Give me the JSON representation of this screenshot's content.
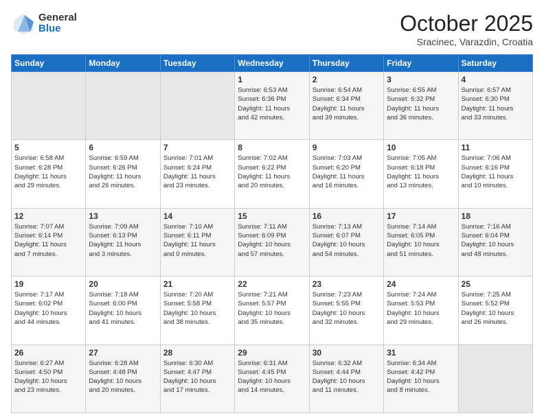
{
  "header": {
    "logo_general": "General",
    "logo_blue": "Blue",
    "month_title": "October 2025",
    "location": "Sracinec, Varazdin, Croatia"
  },
  "days_of_week": [
    "Sunday",
    "Monday",
    "Tuesday",
    "Wednesday",
    "Thursday",
    "Friday",
    "Saturday"
  ],
  "weeks": [
    [
      {
        "day": "",
        "info": ""
      },
      {
        "day": "",
        "info": ""
      },
      {
        "day": "",
        "info": ""
      },
      {
        "day": "1",
        "info": "Sunrise: 6:53 AM\nSunset: 6:36 PM\nDaylight: 11 hours\nand 42 minutes."
      },
      {
        "day": "2",
        "info": "Sunrise: 6:54 AM\nSunset: 6:34 PM\nDaylight: 11 hours\nand 39 minutes."
      },
      {
        "day": "3",
        "info": "Sunrise: 6:55 AM\nSunset: 6:32 PM\nDaylight: 11 hours\nand 36 minutes."
      },
      {
        "day": "4",
        "info": "Sunrise: 6:57 AM\nSunset: 6:30 PM\nDaylight: 11 hours\nand 33 minutes."
      }
    ],
    [
      {
        "day": "5",
        "info": "Sunrise: 6:58 AM\nSunset: 6:28 PM\nDaylight: 11 hours\nand 29 minutes."
      },
      {
        "day": "6",
        "info": "Sunrise: 6:59 AM\nSunset: 6:26 PM\nDaylight: 11 hours\nand 26 minutes."
      },
      {
        "day": "7",
        "info": "Sunrise: 7:01 AM\nSunset: 6:24 PM\nDaylight: 11 hours\nand 23 minutes."
      },
      {
        "day": "8",
        "info": "Sunrise: 7:02 AM\nSunset: 6:22 PM\nDaylight: 11 hours\nand 20 minutes."
      },
      {
        "day": "9",
        "info": "Sunrise: 7:03 AM\nSunset: 6:20 PM\nDaylight: 11 hours\nand 16 minutes."
      },
      {
        "day": "10",
        "info": "Sunrise: 7:05 AM\nSunset: 6:18 PM\nDaylight: 11 hours\nand 13 minutes."
      },
      {
        "day": "11",
        "info": "Sunrise: 7:06 AM\nSunset: 6:16 PM\nDaylight: 11 hours\nand 10 minutes."
      }
    ],
    [
      {
        "day": "12",
        "info": "Sunrise: 7:07 AM\nSunset: 6:14 PM\nDaylight: 11 hours\nand 7 minutes."
      },
      {
        "day": "13",
        "info": "Sunrise: 7:09 AM\nSunset: 6:13 PM\nDaylight: 11 hours\nand 3 minutes."
      },
      {
        "day": "14",
        "info": "Sunrise: 7:10 AM\nSunset: 6:11 PM\nDaylight: 11 hours\nand 0 minutes."
      },
      {
        "day": "15",
        "info": "Sunrise: 7:11 AM\nSunset: 6:09 PM\nDaylight: 10 hours\nand 57 minutes."
      },
      {
        "day": "16",
        "info": "Sunrise: 7:13 AM\nSunset: 6:07 PM\nDaylight: 10 hours\nand 54 minutes."
      },
      {
        "day": "17",
        "info": "Sunrise: 7:14 AM\nSunset: 6:05 PM\nDaylight: 10 hours\nand 51 minutes."
      },
      {
        "day": "18",
        "info": "Sunrise: 7:16 AM\nSunset: 6:04 PM\nDaylight: 10 hours\nand 48 minutes."
      }
    ],
    [
      {
        "day": "19",
        "info": "Sunrise: 7:17 AM\nSunset: 6:02 PM\nDaylight: 10 hours\nand 44 minutes."
      },
      {
        "day": "20",
        "info": "Sunrise: 7:18 AM\nSunset: 6:00 PM\nDaylight: 10 hours\nand 41 minutes."
      },
      {
        "day": "21",
        "info": "Sunrise: 7:20 AM\nSunset: 5:58 PM\nDaylight: 10 hours\nand 38 minutes."
      },
      {
        "day": "22",
        "info": "Sunrise: 7:21 AM\nSunset: 5:57 PM\nDaylight: 10 hours\nand 35 minutes."
      },
      {
        "day": "23",
        "info": "Sunrise: 7:23 AM\nSunset: 5:55 PM\nDaylight: 10 hours\nand 32 minutes."
      },
      {
        "day": "24",
        "info": "Sunrise: 7:24 AM\nSunset: 5:53 PM\nDaylight: 10 hours\nand 29 minutes."
      },
      {
        "day": "25",
        "info": "Sunrise: 7:25 AM\nSunset: 5:52 PM\nDaylight: 10 hours\nand 26 minutes."
      }
    ],
    [
      {
        "day": "26",
        "info": "Sunrise: 6:27 AM\nSunset: 4:50 PM\nDaylight: 10 hours\nand 23 minutes."
      },
      {
        "day": "27",
        "info": "Sunrise: 6:28 AM\nSunset: 4:48 PM\nDaylight: 10 hours\nand 20 minutes."
      },
      {
        "day": "28",
        "info": "Sunrise: 6:30 AM\nSunset: 4:47 PM\nDaylight: 10 hours\nand 17 minutes."
      },
      {
        "day": "29",
        "info": "Sunrise: 6:31 AM\nSunset: 4:45 PM\nDaylight: 10 hours\nand 14 minutes."
      },
      {
        "day": "30",
        "info": "Sunrise: 6:32 AM\nSunset: 4:44 PM\nDaylight: 10 hours\nand 11 minutes."
      },
      {
        "day": "31",
        "info": "Sunrise: 6:34 AM\nSunset: 4:42 PM\nDaylight: 10 hours\nand 8 minutes."
      },
      {
        "day": "",
        "info": ""
      }
    ]
  ]
}
